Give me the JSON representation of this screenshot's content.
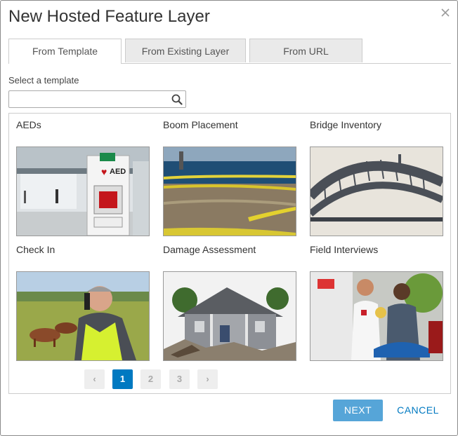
{
  "dialog": {
    "title": "New Hosted Feature Layer",
    "close_icon": "close-icon"
  },
  "tabs": [
    {
      "label": "From Template",
      "active": true
    },
    {
      "label": "From Existing Layer",
      "active": false
    },
    {
      "label": "From URL",
      "active": false
    }
  ],
  "search": {
    "label": "Select a template",
    "value": "",
    "placeholder": "",
    "icon": "search-icon"
  },
  "templates": [
    {
      "label": "AEDs"
    },
    {
      "label": "Boom Placement"
    },
    {
      "label": "Bridge Inventory"
    },
    {
      "label": "Check In"
    },
    {
      "label": "Damage Assessment"
    },
    {
      "label": "Field Interviews"
    }
  ],
  "pagination": {
    "prev": "‹",
    "pages": [
      "1",
      "2",
      "3"
    ],
    "current": "1",
    "next": "›"
  },
  "footer": {
    "next_label": "NEXT",
    "cancel_label": "CANCEL"
  },
  "colors": {
    "accent": "#0079c1",
    "next_button": "#56a5d8"
  }
}
